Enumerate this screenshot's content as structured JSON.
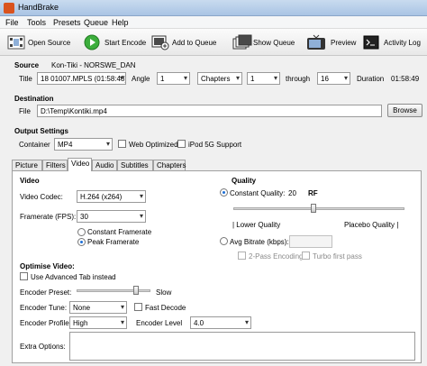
{
  "window": {
    "title": "HandBrake"
  },
  "menu": [
    "File",
    "Tools",
    "Presets",
    "Queue",
    "Help"
  ],
  "toolbar": {
    "open_source": "Open Source",
    "start_encode": "Start Encode",
    "add_to_queue": "Add to Queue",
    "show_queue": "Show Queue",
    "preview": "Preview",
    "activity_log": "Activity Log"
  },
  "source": {
    "heading": "Source",
    "name": "Kon-Tiki - NORSWE_DAN",
    "title_label": "Title",
    "title_value": "18 01007.MPLS (01:58:48)",
    "angle_label": "Angle",
    "angle_value": "1",
    "range_type": "Chapters",
    "range_start": "1",
    "through_label": "through",
    "range_end": "16",
    "duration_label": "Duration",
    "duration_value": "01:58:49"
  },
  "destination": {
    "heading": "Destination",
    "file_label": "File",
    "file_value": "D:\\Temp\\Kontiki.mp4",
    "browse": "Browse"
  },
  "output": {
    "heading": "Output Settings",
    "container_label": "Container",
    "container_value": "MP4",
    "web_optimized": "Web Optimized",
    "ipod": "iPod 5G Support"
  },
  "tabs": [
    "Picture",
    "Filters",
    "Video",
    "Audio",
    "Subtitles",
    "Chapters"
  ],
  "video": {
    "heading": "Video",
    "codec_label": "Video Codec:",
    "codec_value": "H.264 (x264)",
    "framerate_label": "Framerate (FPS):",
    "framerate_value": "30",
    "constant_framerate": "Constant Framerate",
    "peak_framerate": "Peak Framerate"
  },
  "quality": {
    "heading": "Quality",
    "constant_quality": "Constant Quality:",
    "cq_value": "20",
    "rf": "RF",
    "rf_slider_fraction": 0.47,
    "lower_quality": "| Lower Quality",
    "placebo_quality": "Placebo Quality |",
    "avg_bitrate": "Avg Bitrate (kbps):",
    "two_pass": "2-Pass Encoding",
    "turbo": "Turbo first pass"
  },
  "optimise": {
    "heading": "Optimise Video:",
    "advanced_tab": "Use Advanced Tab instead",
    "preset_label": "Encoder Preset:",
    "preset_slider_fraction": 0.8,
    "slow": "Slow",
    "tune_label": "Encoder Tune:",
    "tune_value": "None",
    "fast_decode": "Fast Decode",
    "profile_label": "Encoder Profile:",
    "profile_value": "High",
    "level_label": "Encoder Level",
    "level_value": "4.0",
    "extra_label": "Extra Options:"
  }
}
